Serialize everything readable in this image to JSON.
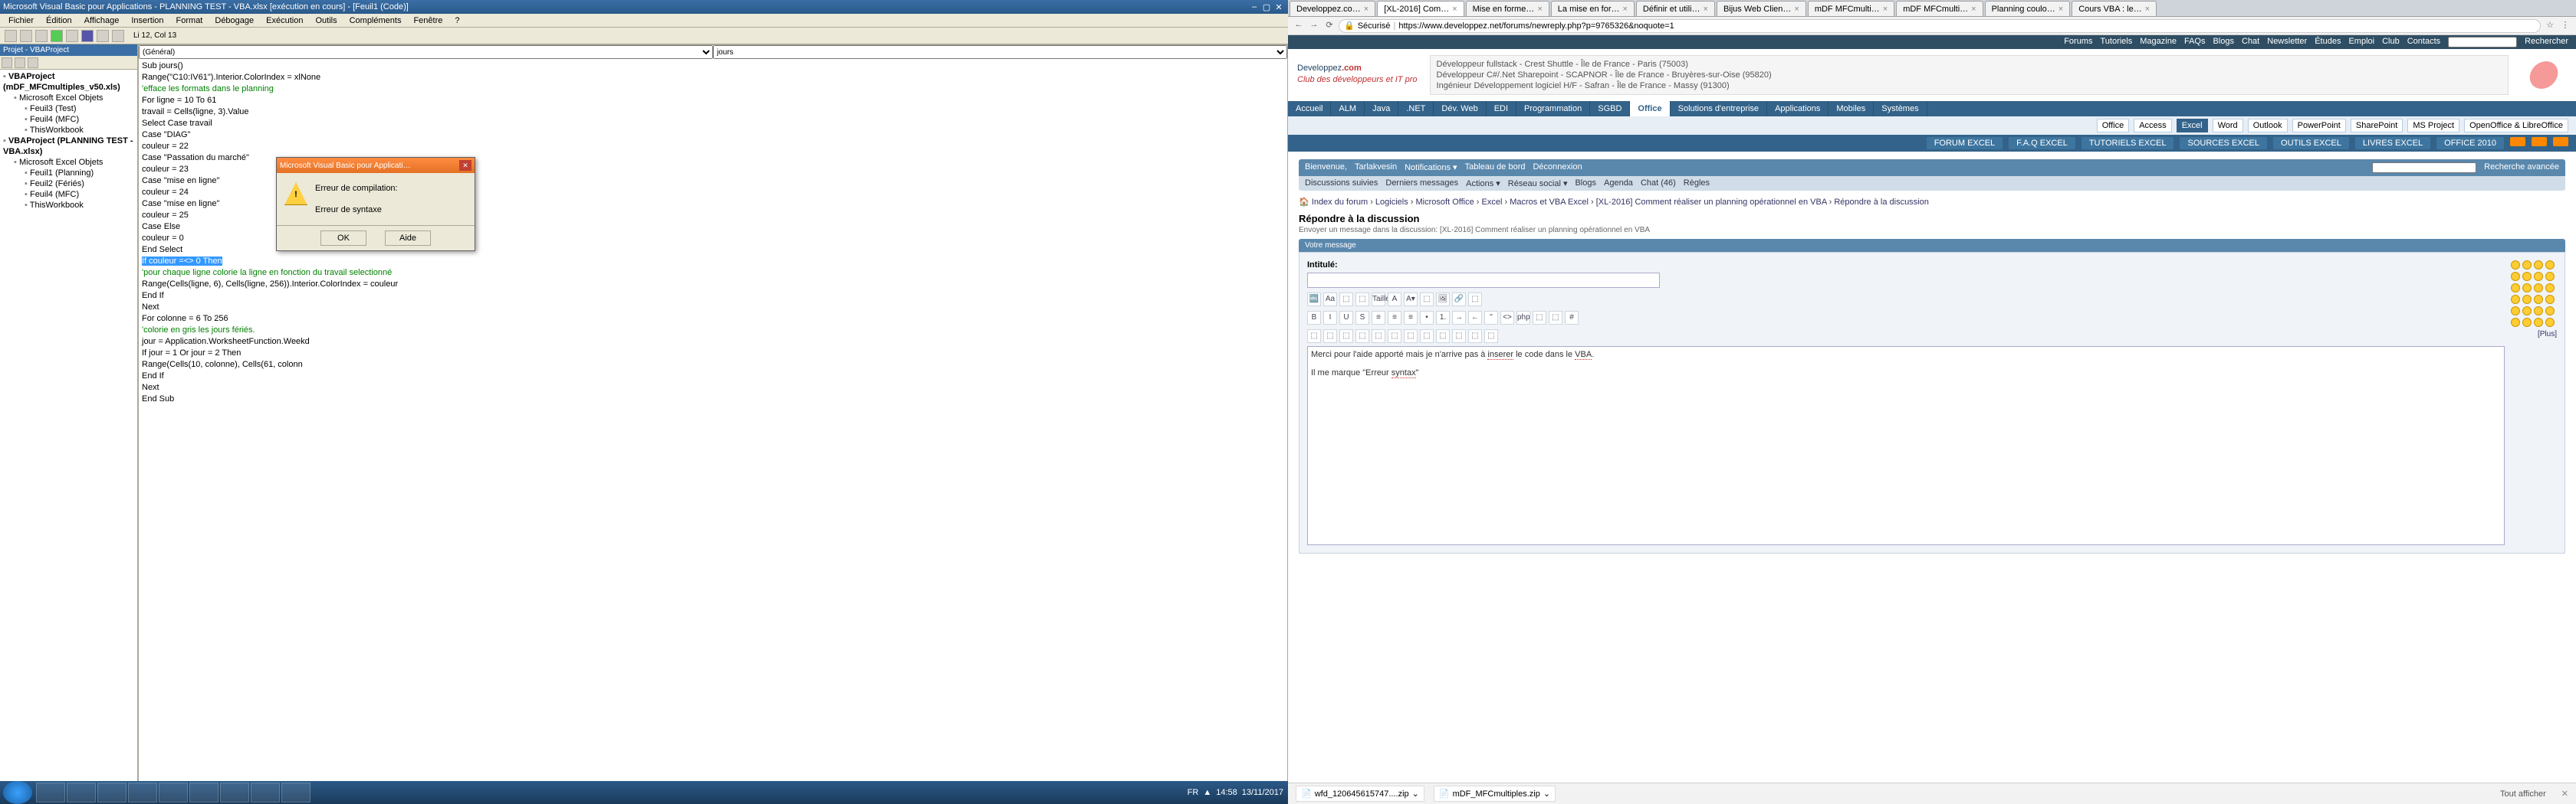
{
  "vba": {
    "title": "Microsoft Visual Basic pour Applications - PLANNING TEST - VBA.xlsx [exécution en cours] - [Feuil1 (Code)]",
    "menu": [
      "Fichier",
      "Édition",
      "Affichage",
      "Insertion",
      "Format",
      "Débogage",
      "Exécution",
      "Outils",
      "Compléments",
      "Fenêtre",
      "?"
    ],
    "cursor": "Li 12, Col 13",
    "project_title": "Projet - VBAProject",
    "tree": [
      {
        "l": 0,
        "t": "VBAProject (mDF_MFCmultiples_v50.xls)",
        "bold": true
      },
      {
        "l": 1,
        "t": "Microsoft Excel Objets"
      },
      {
        "l": 2,
        "t": "Feuil3 (Test)"
      },
      {
        "l": 2,
        "t": "Feuil4 (MFC)"
      },
      {
        "l": 2,
        "t": "ThisWorkbook"
      },
      {
        "l": 0,
        "t": "VBAProject (PLANNING TEST - VBA.xlsx)",
        "bold": true
      },
      {
        "l": 1,
        "t": "Microsoft Excel Objets"
      },
      {
        "l": 2,
        "t": "Feuil1 (Planning)"
      },
      {
        "l": 2,
        "t": "Feuil2 (Fériés)"
      },
      {
        "l": 2,
        "t": "Feuil4 (MFC)"
      },
      {
        "l": 2,
        "t": "ThisWorkbook"
      }
    ],
    "dd_left": "(Général)",
    "dd_right": "jours",
    "code": [
      {
        "t": "Sub jours()"
      },
      {
        "t": "Range(\"C10:IV61\").Interior.ColorIndex = xlNone"
      },
      {
        "t": "'efface les formats dans le planning",
        "c": true
      },
      {
        "t": "For ligne = 10 To 61"
      },
      {
        "t": "travail = Cells(ligne, 3).Value"
      },
      {
        "t": "Select Case travail"
      },
      {
        "t": "Case \"DIAG\""
      },
      {
        "t": "couleur = 22"
      },
      {
        "t": "Case \"Passation du marché\""
      },
      {
        "t": "couleur = 23"
      },
      {
        "t": "Case \"mise en ligne\""
      },
      {
        "t": "couleur = 24"
      },
      {
        "t": "Case \"mise en ligne\""
      },
      {
        "t": "couleur = 25"
      },
      {
        "t": "Case Else"
      },
      {
        "t": "couleur = 0"
      },
      {
        "t": "End Select"
      },
      {
        "t": "If couleur =<> 0 Then",
        "sel": true
      },
      {
        "t": "'pour chaque ligne colorie la ligne en fonction du travail selectionné",
        "c": true
      },
      {
        "t": "Range(Cells(ligne, 6), Cells(ligne, 256)).Interior.ColorIndex = couleur"
      },
      {
        "t": "End If"
      },
      {
        "t": "Next"
      },
      {
        "t": "For colonne = 6 To 256"
      },
      {
        "t": "'colorie en gris les jours fériés.",
        "c": true
      },
      {
        "t": "jour = Application.WorksheetFunction.Weekd"
      },
      {
        "t": "If jour = 1 Or jour = 2 Then"
      },
      {
        "t": "Range(Cells(10, colonne), Cells(61, colonn"
      },
      {
        "t": "End If"
      },
      {
        "t": "Next"
      },
      {
        "t": "End Sub"
      }
    ],
    "dialog": {
      "title": "Microsoft Visual Basic pour Applicati…",
      "line1": "Erreur de compilation:",
      "line2": "Erreur de syntaxe",
      "ok": "OK",
      "help": "Aide"
    },
    "taskbar": {
      "lang": "FR",
      "time": "14:58",
      "date": "13/11/2017"
    }
  },
  "chrome": {
    "tabs": [
      {
        "label": "Developpez.co…"
      },
      {
        "label": "[XL-2016] Com…",
        "active": true
      },
      {
        "label": "Mise en forme…"
      },
      {
        "label": "La mise en for…"
      },
      {
        "label": "Définir et utili…"
      },
      {
        "label": "Bijus Web Clien…"
      },
      {
        "label": "mDF MFCmulti…"
      },
      {
        "label": "mDF MFCmulti…"
      },
      {
        "label": "Planning coulo…"
      },
      {
        "label": "Cours VBA : le…"
      }
    ],
    "secure": "Sécurisé",
    "url": "https://www.developpez.net/forums/newreply.php?p=9765326&noquote=1",
    "topnav": [
      "Forums",
      "Tutoriels",
      "Magazine",
      "FAQs",
      "Blogs",
      "Chat",
      "Newsletter",
      "Études",
      "Emploi",
      "Club",
      "Contacts"
    ],
    "search_ph": "Rechercher",
    "logo_a": "Developpez",
    "logo_b": ".com",
    "tagline": "Club des développeurs et IT pro",
    "ads": [
      "Développeur fullstack - Crest Shuttle - Île de France - Paris (75003)",
      "Développeur C#/.Net Sharepoint - SCAPNOR - Île de France - Bruyères-sur-Oise (95820)",
      "Ingénieur Développement logiciel H/F - Safran - Île de France - Massy (91300)"
    ],
    "nav1": [
      "Accueil",
      "ALM",
      "Java",
      ".NET",
      "Dév. Web",
      "EDI",
      "Programmation",
      "SGBD",
      "Office",
      "Solutions d'entreprise",
      "Applications",
      "Mobiles",
      "Systèmes"
    ],
    "nav1_active": "Office",
    "nav2": [
      "Office",
      "Access",
      "Excel",
      "Word",
      "Outlook",
      "PowerPoint",
      "SharePoint",
      "MS Project",
      "OpenOffice & LibreOffice"
    ],
    "nav2_active": "Excel",
    "nav3": [
      "FORUM EXCEL",
      "F.A.Q EXCEL",
      "TUTORIELS EXCEL",
      "SOURCES EXCEL",
      "OUTILS EXCEL",
      "LIVRES EXCEL",
      "OFFICE 2010"
    ],
    "forumbar": [
      "Bienvenue,",
      "Tarlakvesin",
      "Notifications ▾",
      "Tableau de bord",
      "Déconnexion"
    ],
    "forumbar_search": "Recherche avancée",
    "forumbar2": [
      "Discussions suivies",
      "Derniers messages",
      "Actions ▾",
      "Réseau social ▾",
      "Blogs",
      "Agenda",
      "Chat (46)",
      "Règles"
    ],
    "crumbs": [
      "Index du forum",
      "Logiciels",
      "Microsoft Office",
      "Excel",
      "Macros et VBA Excel",
      "[XL-2016] Comment réaliser un planning opérationnel en VBA",
      "Répondre à la discussion"
    ],
    "reply_title": "Répondre à la discussion",
    "reply_sub": "Envoyer un message dans la discussion: [XL-2016] Comment réaliser un planning opérationnel en VBA",
    "msg_head": "Votre message",
    "intitule": "Intitulé:",
    "editor_lines": [
      {
        "pre": "Merci pour l'aide apporté mais je n'arrive pas à ",
        "u": "inserer",
        "post": " le code dans le "
      },
      {
        "u2": "VBA",
        "post2": "."
      },
      {
        "blank": true
      },
      {
        "pre": "Il me marque \"Erreur ",
        "u": "syntax",
        "post": "\""
      }
    ],
    "plus": "[Plus]",
    "downloads": [
      "wfd_120645615747....zip",
      "mDF_MFCmultiples.zip"
    ],
    "show_all": "Tout afficher"
  }
}
